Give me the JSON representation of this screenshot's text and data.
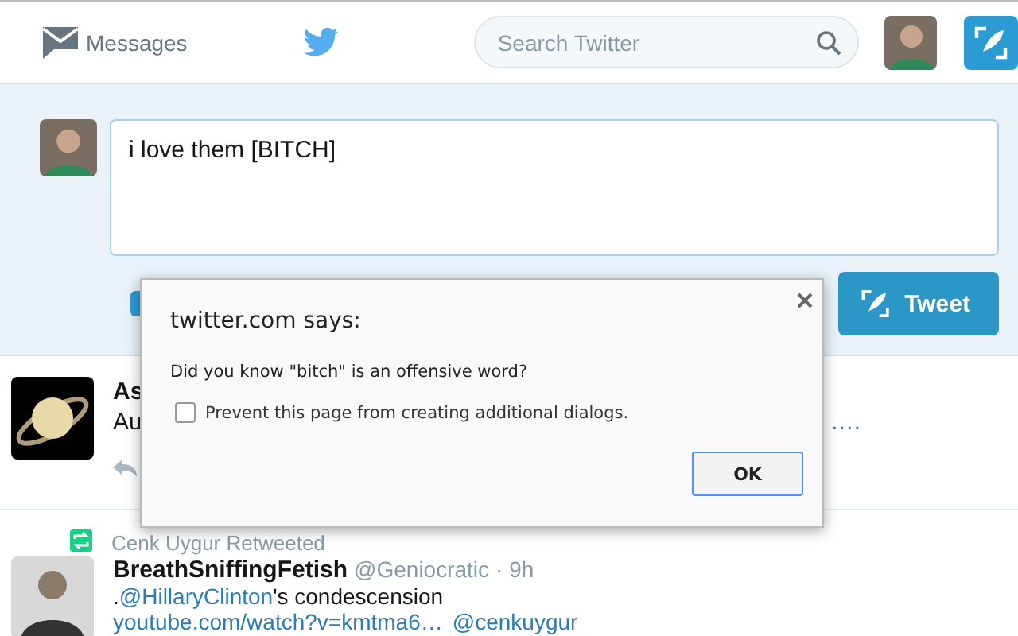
{
  "nav": {
    "messages_label": "Messages",
    "search": {
      "placeholder": "Search Twitter"
    }
  },
  "compose": {
    "value": "i love them [BITCH]",
    "button": "Tweet"
  },
  "tweets": [
    {
      "kind": "plain",
      "name": "As",
      "lines": [
        [
          {
            "text": "Au",
            "link": false
          },
          {
            "text": "….",
            "link": true
          }
        ]
      ]
    },
    {
      "kind": "retweet",
      "context": "Cenk Uygur Retweeted",
      "name": "BreathSniffingFetish",
      "handle": "@Geniocratic",
      "time": "· 9h",
      "lines": [
        [
          {
            "text": ".",
            "link": false
          },
          {
            "text": "@HillaryClinton",
            "link": true
          },
          {
            "text": "'s condescension",
            "link": false
          }
        ],
        [
          {
            "text": "youtube.com/watch?v=kmtma6…",
            "link": true
          },
          {
            "text": "@cenkuygur",
            "link": true
          }
        ]
      ]
    }
  ],
  "dialog": {
    "title": "twitter.com says:",
    "message": "Did you know \"bitch\" is an offensive word?",
    "checkbox": {
      "label": "Prevent this page from creating additional dialogs.",
      "checked": false
    },
    "button": "OK"
  }
}
